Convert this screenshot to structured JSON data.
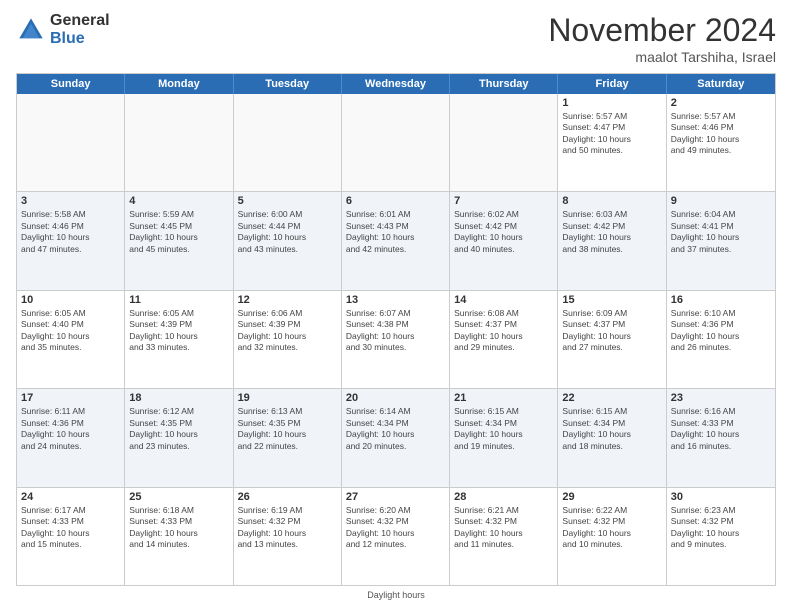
{
  "logo": {
    "general": "General",
    "blue": "Blue"
  },
  "header": {
    "month": "November 2024",
    "location": "maalot Tarshiha, Israel"
  },
  "days_of_week": [
    "Sunday",
    "Monday",
    "Tuesday",
    "Wednesday",
    "Thursday",
    "Friday",
    "Saturday"
  ],
  "footer": {
    "daylight_label": "Daylight hours"
  },
  "weeks": [
    {
      "alt": false,
      "cells": [
        {
          "day": "",
          "info": ""
        },
        {
          "day": "",
          "info": ""
        },
        {
          "day": "",
          "info": ""
        },
        {
          "day": "",
          "info": ""
        },
        {
          "day": "",
          "info": ""
        },
        {
          "day": "1",
          "info": "Sunrise: 5:57 AM\nSunset: 4:47 PM\nDaylight: 10 hours\nand 50 minutes."
        },
        {
          "day": "2",
          "info": "Sunrise: 5:57 AM\nSunset: 4:46 PM\nDaylight: 10 hours\nand 49 minutes."
        }
      ]
    },
    {
      "alt": true,
      "cells": [
        {
          "day": "3",
          "info": "Sunrise: 5:58 AM\nSunset: 4:46 PM\nDaylight: 10 hours\nand 47 minutes."
        },
        {
          "day": "4",
          "info": "Sunrise: 5:59 AM\nSunset: 4:45 PM\nDaylight: 10 hours\nand 45 minutes."
        },
        {
          "day": "5",
          "info": "Sunrise: 6:00 AM\nSunset: 4:44 PM\nDaylight: 10 hours\nand 43 minutes."
        },
        {
          "day": "6",
          "info": "Sunrise: 6:01 AM\nSunset: 4:43 PM\nDaylight: 10 hours\nand 42 minutes."
        },
        {
          "day": "7",
          "info": "Sunrise: 6:02 AM\nSunset: 4:42 PM\nDaylight: 10 hours\nand 40 minutes."
        },
        {
          "day": "8",
          "info": "Sunrise: 6:03 AM\nSunset: 4:42 PM\nDaylight: 10 hours\nand 38 minutes."
        },
        {
          "day": "9",
          "info": "Sunrise: 6:04 AM\nSunset: 4:41 PM\nDaylight: 10 hours\nand 37 minutes."
        }
      ]
    },
    {
      "alt": false,
      "cells": [
        {
          "day": "10",
          "info": "Sunrise: 6:05 AM\nSunset: 4:40 PM\nDaylight: 10 hours\nand 35 minutes."
        },
        {
          "day": "11",
          "info": "Sunrise: 6:05 AM\nSunset: 4:39 PM\nDaylight: 10 hours\nand 33 minutes."
        },
        {
          "day": "12",
          "info": "Sunrise: 6:06 AM\nSunset: 4:39 PM\nDaylight: 10 hours\nand 32 minutes."
        },
        {
          "day": "13",
          "info": "Sunrise: 6:07 AM\nSunset: 4:38 PM\nDaylight: 10 hours\nand 30 minutes."
        },
        {
          "day": "14",
          "info": "Sunrise: 6:08 AM\nSunset: 4:37 PM\nDaylight: 10 hours\nand 29 minutes."
        },
        {
          "day": "15",
          "info": "Sunrise: 6:09 AM\nSunset: 4:37 PM\nDaylight: 10 hours\nand 27 minutes."
        },
        {
          "day": "16",
          "info": "Sunrise: 6:10 AM\nSunset: 4:36 PM\nDaylight: 10 hours\nand 26 minutes."
        }
      ]
    },
    {
      "alt": true,
      "cells": [
        {
          "day": "17",
          "info": "Sunrise: 6:11 AM\nSunset: 4:36 PM\nDaylight: 10 hours\nand 24 minutes."
        },
        {
          "day": "18",
          "info": "Sunrise: 6:12 AM\nSunset: 4:35 PM\nDaylight: 10 hours\nand 23 minutes."
        },
        {
          "day": "19",
          "info": "Sunrise: 6:13 AM\nSunset: 4:35 PM\nDaylight: 10 hours\nand 22 minutes."
        },
        {
          "day": "20",
          "info": "Sunrise: 6:14 AM\nSunset: 4:34 PM\nDaylight: 10 hours\nand 20 minutes."
        },
        {
          "day": "21",
          "info": "Sunrise: 6:15 AM\nSunset: 4:34 PM\nDaylight: 10 hours\nand 19 minutes."
        },
        {
          "day": "22",
          "info": "Sunrise: 6:15 AM\nSunset: 4:34 PM\nDaylight: 10 hours\nand 18 minutes."
        },
        {
          "day": "23",
          "info": "Sunrise: 6:16 AM\nSunset: 4:33 PM\nDaylight: 10 hours\nand 16 minutes."
        }
      ]
    },
    {
      "alt": false,
      "cells": [
        {
          "day": "24",
          "info": "Sunrise: 6:17 AM\nSunset: 4:33 PM\nDaylight: 10 hours\nand 15 minutes."
        },
        {
          "day": "25",
          "info": "Sunrise: 6:18 AM\nSunset: 4:33 PM\nDaylight: 10 hours\nand 14 minutes."
        },
        {
          "day": "26",
          "info": "Sunrise: 6:19 AM\nSunset: 4:32 PM\nDaylight: 10 hours\nand 13 minutes."
        },
        {
          "day": "27",
          "info": "Sunrise: 6:20 AM\nSunset: 4:32 PM\nDaylight: 10 hours\nand 12 minutes."
        },
        {
          "day": "28",
          "info": "Sunrise: 6:21 AM\nSunset: 4:32 PM\nDaylight: 10 hours\nand 11 minutes."
        },
        {
          "day": "29",
          "info": "Sunrise: 6:22 AM\nSunset: 4:32 PM\nDaylight: 10 hours\nand 10 minutes."
        },
        {
          "day": "30",
          "info": "Sunrise: 6:23 AM\nSunset: 4:32 PM\nDaylight: 10 hours\nand 9 minutes."
        }
      ]
    }
  ]
}
